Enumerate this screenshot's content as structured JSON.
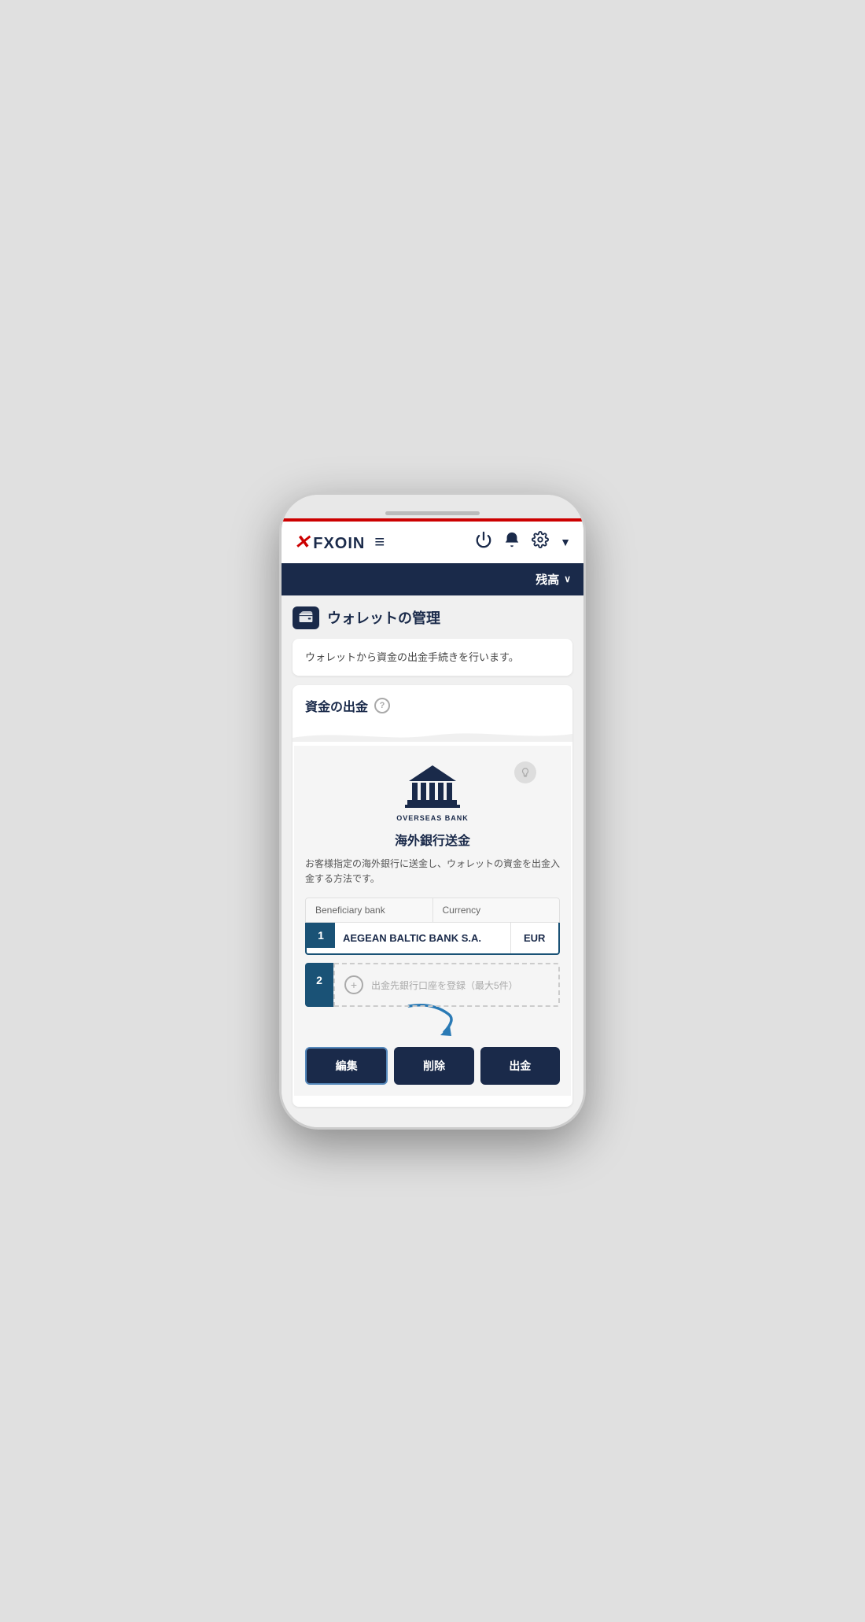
{
  "header": {
    "logo": "FXOIN",
    "balance_label": "残高",
    "hamburger_icon": "≡",
    "power_icon": "⏻",
    "bell_icon": "🔔",
    "gear_icon": "⚙"
  },
  "page": {
    "wallet_icon": "💳",
    "title": "ウォレットの管理",
    "info_text": "ウォレットから資金の出金手続きを行います。",
    "section_title": "資金の出金",
    "bank_section_label": "OVERSEAS BANK",
    "bank_section_title": "海外銀行送金",
    "bank_description": "お客様指定の海外銀行に送金し、ウォレットの資金を出金入金する方法です。",
    "table_header": {
      "beneficiary_bank": "Beneficiary bank",
      "currency": "Currency"
    },
    "bank_row_1": {
      "number": "1",
      "bank_name": "AEGEAN BALTIC BANK S.A.",
      "currency": "EUR"
    },
    "bank_row_2": {
      "number": "2"
    },
    "add_bank_text": "出金先銀行口座を登録（最大5件）",
    "buttons": {
      "edit": "編集",
      "delete": "削除",
      "withdraw": "出金"
    }
  }
}
